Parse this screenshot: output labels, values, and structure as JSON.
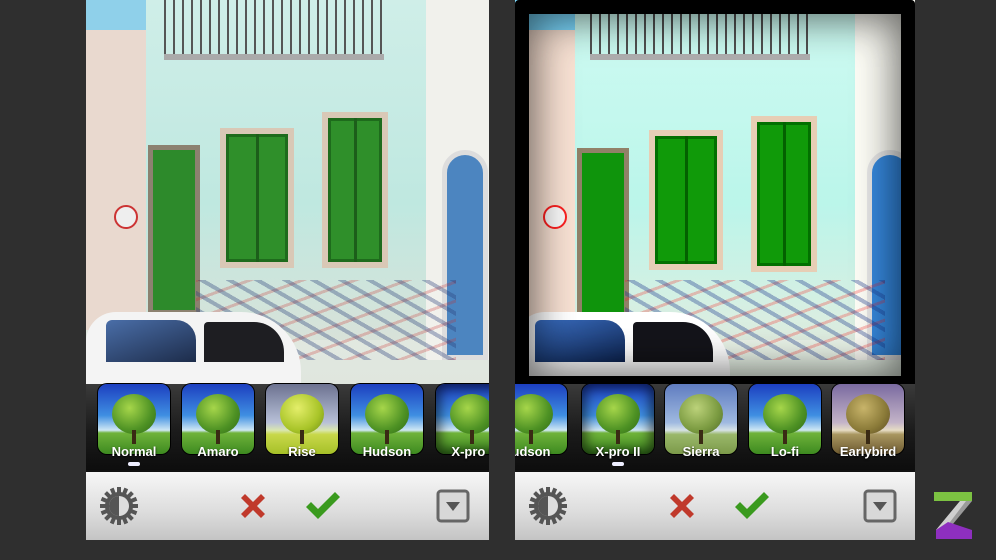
{
  "left_screen": {
    "filters": [
      {
        "label": "Normal",
        "style": "normal",
        "selected": true
      },
      {
        "label": "Amaro",
        "style": "normal"
      },
      {
        "label": "Rise",
        "style": "rise"
      },
      {
        "label": "Hudson",
        "style": "normal"
      },
      {
        "label": "X-pro I",
        "style": "xpro"
      }
    ]
  },
  "right_screen": {
    "filters": [
      {
        "label": "udson",
        "style": "normal"
      },
      {
        "label": "X-pro II",
        "style": "xpro",
        "selected": true
      },
      {
        "label": "Sierra",
        "style": "sierra"
      },
      {
        "label": "Lo-fi",
        "style": "normal"
      },
      {
        "label": "Earlybird",
        "style": "early"
      }
    ]
  },
  "toolbar": {
    "icons": [
      "brightness-gear-icon",
      "cancel-x-icon",
      "confirm-check-icon",
      "dropdown-icon"
    ]
  },
  "colors": {
    "cancel": "#c0392b",
    "confirm": "#3a9a1e",
    "logo_green": "#7cc242",
    "logo_purple": "#8e2fbf"
  }
}
